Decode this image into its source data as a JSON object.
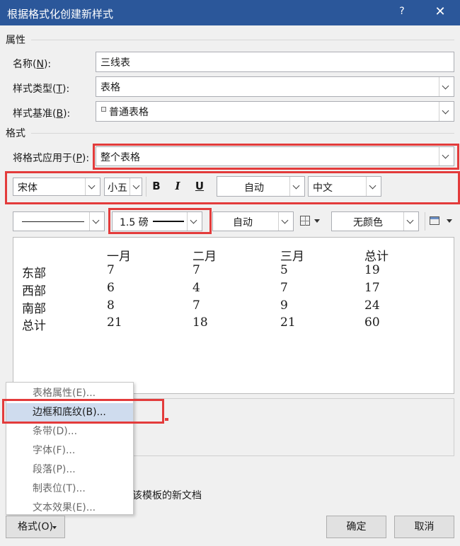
{
  "window": {
    "title": "根据格式化创建新样式",
    "help": "?",
    "close": "✕"
  },
  "properties": {
    "section_title": "属性",
    "name_label": "名称(",
    "name_key": "N",
    "name_tail": "):",
    "name_value": "三线表",
    "type_label": "样式类型(",
    "type_key": "T",
    "type_tail": "):",
    "type_value": "表格",
    "base_label": "样式基准(",
    "base_key": "B",
    "base_tail": "):",
    "base_value": "普通表格"
  },
  "format": {
    "section_title": "格式",
    "apply_label": "将格式应用于(",
    "apply_key": "P",
    "apply_tail": "):",
    "apply_value": "整个表格",
    "font_name": "宋体",
    "font_size": "小五",
    "bold": "B",
    "italic": "I",
    "underline": "U",
    "font_color": "自动",
    "script": "中文",
    "border_weight": "1.5 磅",
    "border_color": "自动",
    "shading": "无颜色"
  },
  "preview": {
    "headers": [
      "",
      "一月",
      "二月",
      "三月",
      "总计"
    ],
    "rows": [
      [
        "东部",
        "7",
        "7",
        "5",
        "19"
      ],
      [
        "西部",
        "6",
        "4",
        "7",
        "17"
      ],
      [
        "南部",
        "8",
        "7",
        "9",
        "24"
      ],
      [
        "总计",
        "21",
        "18",
        "21",
        "60"
      ]
    ]
  },
  "template_option_partial": "该模板的新文档",
  "format_menu": {
    "button_label": "格式(O)",
    "items": [
      "表格属性(E)...",
      "边框和底纹(B)...",
      "条带(D)...",
      "字体(F)...",
      "段落(P)...",
      "制表位(T)...",
      "文本效果(E)..."
    ],
    "highlighted_index": 1
  },
  "buttons": {
    "ok": "确定",
    "cancel": "取消"
  },
  "colors": {
    "titlebar": "#2b579a",
    "highlight_border": "#e33b3b",
    "menu_highlight": "#cfdcee"
  }
}
